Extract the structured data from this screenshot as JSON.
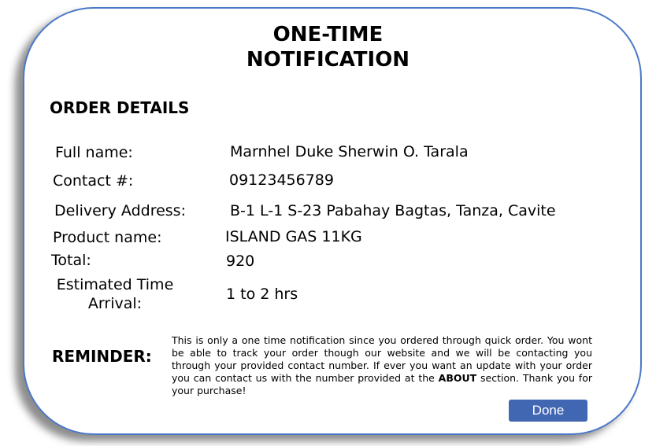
{
  "title_line1": "ONE-TIME",
  "title_line2": "NOTIFICATION",
  "section_heading": "ORDER DETAILS",
  "fields": {
    "full_name": {
      "label": "Full name:",
      "value": "Marnhel Duke Sherwin O. Tarala"
    },
    "contact": {
      "label": "Contact #:",
      "value": "09123456789"
    },
    "address": {
      "label": "Delivery Address:",
      "value": "B-1 L-1 S-23 Pabahay Bagtas, Tanza, Cavite"
    },
    "product": {
      "label": "Product name:",
      "value": "ISLAND GAS 11KG"
    },
    "total": {
      "label": "Total:",
      "value": "920"
    },
    "eta": {
      "label_line1": "Estimated Time",
      "label_line2": "Arrival:",
      "value": "1 to 2 hrs"
    }
  },
  "reminder": {
    "label": "REMINDER:",
    "text_before": "This is only a one time notification since you ordered through quick order. You wont be able to track your order though our website and we will be contacting you through your provided contact number. If ever you want an update with your order you can contact us with the number provided at the ",
    "text_bold": "ABOUT",
    "text_after": " section. Thank you for your purchase!"
  },
  "done_label": "Done",
  "colors": {
    "border": "#4a78c8",
    "button": "#4267b2"
  }
}
